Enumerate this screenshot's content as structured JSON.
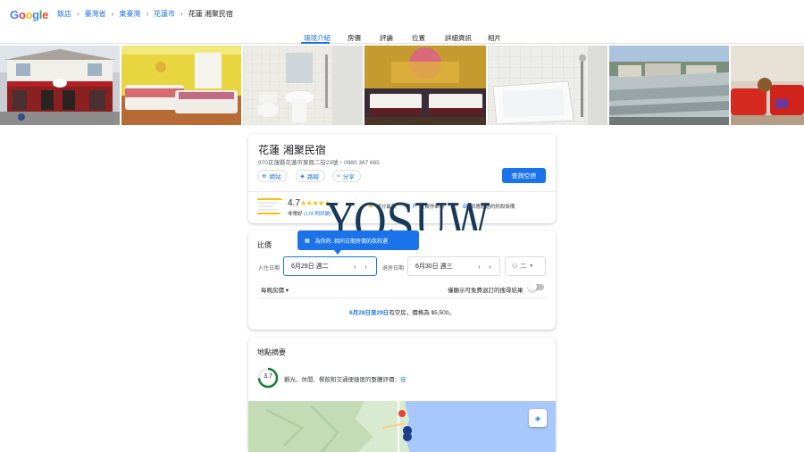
{
  "header": {
    "logo_text": "Google",
    "breadcrumbs": [
      "飯店",
      "臺灣省",
      "東臺灣",
      "花蓮市",
      "花蓮 湘聚民宿"
    ]
  },
  "tabs": [
    "環境介紹",
    "房價",
    "評論",
    "位置",
    "詳細資訊",
    "相片"
  ],
  "active_tab": "環境介紹",
  "photos": [
    {
      "icon": "building-exterior-photo"
    },
    {
      "icon": "yellow-bedroom-photo"
    },
    {
      "icon": "bathroom-sink-photo"
    },
    {
      "icon": "carousel-bedroom-photo"
    },
    {
      "icon": "bathtub-photo"
    },
    {
      "icon": "rooftop-view-photo"
    },
    {
      "icon": "red-sofa-lounge-photo"
    }
  ],
  "hotel": {
    "name": "花蓮 湘聚民宿",
    "address": "970花蓮縣花蓮市東興二街23號・0980 367 665",
    "actions": {
      "website": "網站",
      "directions": "路線",
      "share": "分享"
    },
    "check_button": "查詢空房",
    "rating": "4.7",
    "stars": "★★★★★",
    "rating_word": "非常好",
    "reviews": "(178 則評論)",
    "amenities": [
      "評分最高",
      "免費停車場",
      "供應經過的附設設備"
    ]
  },
  "watermark": "YOSUW",
  "prices": {
    "title": "比價",
    "tooltip": "為你的..相同日期房價的我和選",
    "checkin_label": "入住日期",
    "checkin_value": "6月29日 週二",
    "checkout_label": "退房日期",
    "checkout_value": "6月30日 週三",
    "guests": "二",
    "per_night": "每晚房價 ▾",
    "free_cancel": "僅顯示可免費退訂的搜尋結果",
    "availability_dates": "6月28日至29日",
    "availability_rest": "有空房，價格為 $5,500。"
  },
  "location": {
    "title": "地點摘要",
    "score": "3.7",
    "score_text_prefix": "觀光、休閒、餐飲和交通便捷度的整體評價：",
    "score_text_grade": "佳"
  },
  "colors": {
    "accent": "#1a73e8",
    "star": "#fbbc04",
    "watermark": "#17395a",
    "score_ring": "#188038"
  }
}
